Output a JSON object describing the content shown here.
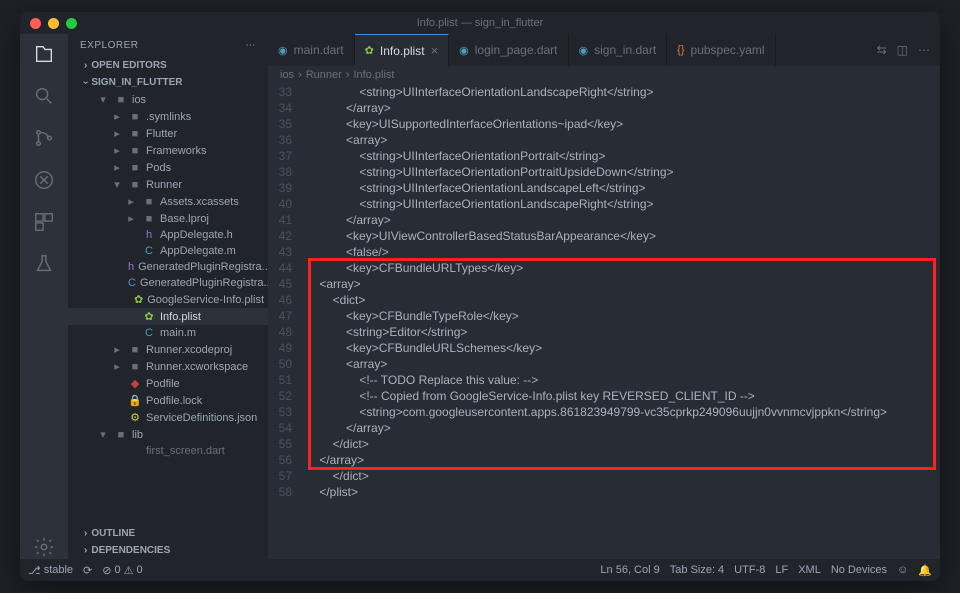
{
  "window_title": "Info.plist — sign_in_flutter",
  "sidebar_title": "EXPLORER",
  "sections": {
    "open_editors": "OPEN EDITORS",
    "project": "SIGN_IN_FLUTTER",
    "outline": "OUTLINE",
    "deps": "DEPENDENCIES"
  },
  "tree": [
    {
      "l": 1,
      "icon": "▾",
      "name": "ios",
      "cls": "folder-open"
    },
    {
      "l": 2,
      "icon": "",
      "name": ".symlinks",
      "cls": "folder"
    },
    {
      "l": 2,
      "icon": "",
      "name": "Flutter",
      "cls": "folder"
    },
    {
      "l": 2,
      "icon": "",
      "name": "Frameworks",
      "cls": "folder"
    },
    {
      "l": 2,
      "icon": "",
      "name": "Pods",
      "cls": "folder"
    },
    {
      "l": 2,
      "icon": "▾",
      "name": "Runner",
      "cls": "folder-open"
    },
    {
      "l": 3,
      "icon": "",
      "name": "Assets.xcassets",
      "cls": "folder"
    },
    {
      "l": 3,
      "icon": "",
      "name": "Base.lproj",
      "cls": "folder"
    },
    {
      "l": 3,
      "icon": "h",
      "name": "AppDelegate.h",
      "cls": "file-h"
    },
    {
      "l": 3,
      "icon": "C",
      "name": "AppDelegate.m",
      "cls": "file-c"
    },
    {
      "l": 3,
      "icon": "h",
      "name": "GeneratedPluginRegistra...",
      "cls": "file-h"
    },
    {
      "l": 3,
      "icon": "C",
      "name": "GeneratedPluginRegistra...",
      "cls": "file-c"
    },
    {
      "l": 3,
      "icon": "✿",
      "name": "GoogleService-Info.plist",
      "cls": "file-plist"
    },
    {
      "l": 3,
      "icon": "✿",
      "name": "Info.plist",
      "cls": "file-plist",
      "sel": true
    },
    {
      "l": 3,
      "icon": "C",
      "name": "main.m",
      "cls": "file-c"
    },
    {
      "l": 2,
      "icon": "",
      "name": "Runner.xcodeproj",
      "cls": "folder"
    },
    {
      "l": 2,
      "icon": "",
      "name": "Runner.xcworkspace",
      "cls": "folder"
    },
    {
      "l": 2,
      "icon": "◆",
      "name": "Podfile",
      "cls": "file-ruby"
    },
    {
      "l": 2,
      "icon": "🔒",
      "name": "Podfile.lock",
      "cls": "file-lock"
    },
    {
      "l": 2,
      "icon": "⚙",
      "name": "ServiceDefinitions.json",
      "cls": "file-json"
    },
    {
      "l": 1,
      "icon": "▾",
      "name": "lib",
      "cls": "folder-open"
    },
    {
      "l": 2,
      "icon": "",
      "name": "first_screen.dart",
      "cls": "file-dart",
      "dim": true
    }
  ],
  "tabs": [
    {
      "icon": "◉",
      "name": "main.dart",
      "color": "#519aba"
    },
    {
      "icon": "✿",
      "name": "Info.plist",
      "active": true,
      "color": "#8dc149"
    },
    {
      "icon": "◉",
      "name": "login_page.dart",
      "color": "#519aba"
    },
    {
      "icon": "◉",
      "name": "sign_in.dart",
      "color": "#519aba"
    },
    {
      "icon": "{}",
      "name": "pubspec.yaml",
      "color": "#e37933"
    }
  ],
  "breadcrumbs": [
    "ios",
    "Runner",
    "Info.plist"
  ],
  "code": [
    {
      "n": 33,
      "t": "                <string>UIInterfaceOrientationLandscapeRight</string>"
    },
    {
      "n": 34,
      "t": "            </array>"
    },
    {
      "n": 35,
      "t": "            <key>UISupportedInterfaceOrientations~ipad</key>"
    },
    {
      "n": 36,
      "t": "            <array>"
    },
    {
      "n": 37,
      "t": "                <string>UIInterfaceOrientationPortrait</string>"
    },
    {
      "n": 38,
      "t": "                <string>UIInterfaceOrientationPortraitUpsideDown</string>"
    },
    {
      "n": 39,
      "t": "                <string>UIInterfaceOrientationLandscapeLeft</string>"
    },
    {
      "n": 40,
      "t": "                <string>UIInterfaceOrientationLandscapeRight</string>"
    },
    {
      "n": 41,
      "t": "            </array>"
    },
    {
      "n": 42,
      "t": "            <key>UIViewControllerBasedStatusBarAppearance</key>"
    },
    {
      "n": 43,
      "t": "            <false/>"
    },
    {
      "n": 44,
      "t": "            <key>CFBundleURLTypes</key>"
    },
    {
      "n": 45,
      "t": "    <array>"
    },
    {
      "n": 46,
      "t": "        <dict>"
    },
    {
      "n": 47,
      "t": "            <key>CFBundleTypeRole</key>"
    },
    {
      "n": 48,
      "t": "            <string>Editor</string>"
    },
    {
      "n": 49,
      "t": "            <key>CFBundleURLSchemes</key>"
    },
    {
      "n": 50,
      "t": "            <array>"
    },
    {
      "n": 51,
      "t": "                <!-- TODO Replace this value: -->"
    },
    {
      "n": 52,
      "t": "                <!-- Copied from GoogleService-Info.plist key REVERSED_CLIENT_ID -->"
    },
    {
      "n": 53,
      "t": "                <string>com.googleusercontent.apps.861823949799-vc35cprkp249096uujjn0vvnmcvjppkn</string>"
    },
    {
      "n": 54,
      "t": "            </array>"
    },
    {
      "n": 55,
      "t": "        </dict>"
    },
    {
      "n": 56,
      "t": "    </array>"
    },
    {
      "n": 57,
      "t": "        </dict>"
    },
    {
      "n": 58,
      "t": "    </plist>"
    }
  ],
  "highlight": {
    "start": 44,
    "end": 56
  },
  "status": {
    "branch": "stable",
    "sync": "⟳",
    "errors": "0",
    "warnings": "0",
    "pos": "Ln 56, Col 9",
    "tab": "Tab Size: 4",
    "enc": "UTF-8",
    "eol": "LF",
    "lang": "XML",
    "device": "No Devices"
  }
}
